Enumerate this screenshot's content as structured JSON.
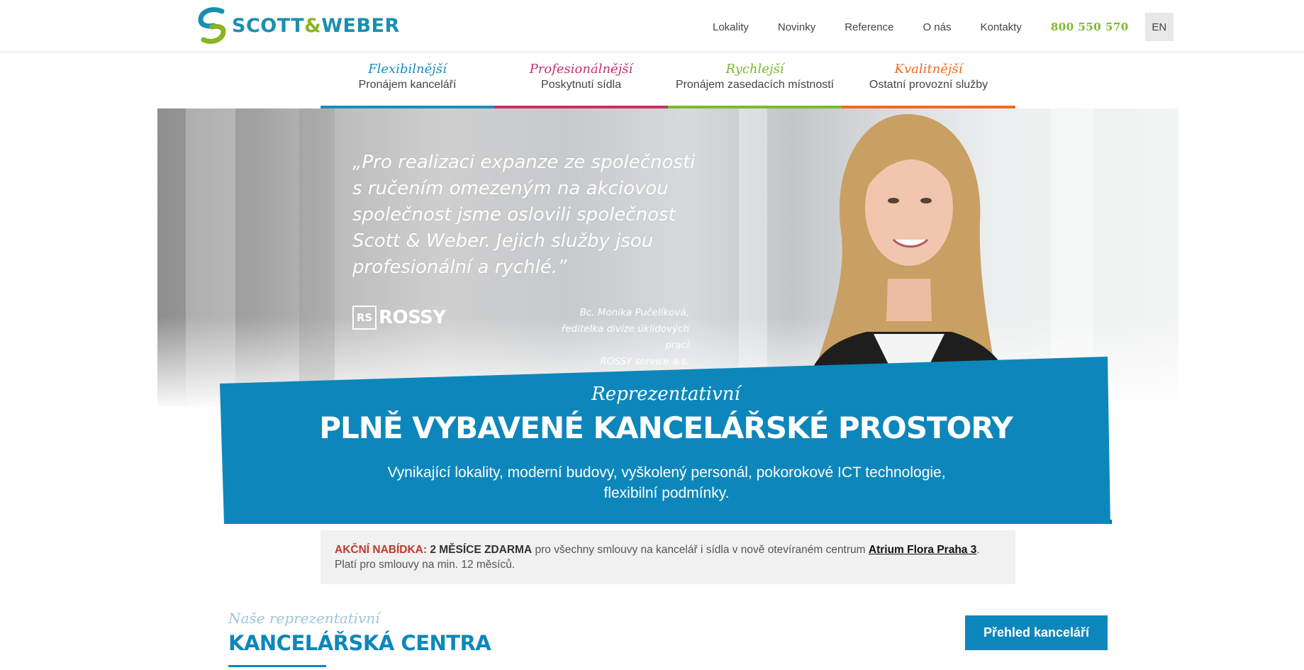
{
  "header": {
    "logo_text": "SCOTT",
    "logo_amp": "&",
    "logo_text2": "WEBER",
    "nav": [
      {
        "label": "Lokality"
      },
      {
        "label": "Novinky"
      },
      {
        "label": "Reference"
      },
      {
        "label": "O nás"
      },
      {
        "label": "Kontakty"
      }
    ],
    "phone": "800 550 570",
    "lang": "EN"
  },
  "tabs": [
    {
      "title": "Flexibilnější",
      "subtitle": "Pronájem kanceláří",
      "color": "#1a8fb9"
    },
    {
      "title": "Profesionálnější",
      "subtitle": "Poskytnutí sídla",
      "color": "#c7306a"
    },
    {
      "title": "Rychlejší",
      "subtitle": "Pronájem zasedacích místností",
      "color": "#7cb92c"
    },
    {
      "title": "Kvalitnější",
      "subtitle": "Ostatní provozní služby",
      "color": "#f26a21"
    }
  ],
  "hero": {
    "quote": "„Pro realizaci expanze ze společnosti s ručením omezeným na akciovou společnost jsme oslovili společnost Scott & Weber. Jejich služby jsou profesionální a rychlé.”",
    "sig_name": "Bc. Monika Pučelíková,",
    "sig_role": "ředitelka divize úklidových prací",
    "sig_company": "ROSSY service a.s.",
    "brand_mark": "RS",
    "brand_word": "ROSSY"
  },
  "banner": {
    "kicker": "Reprezentativní",
    "title": "PLNĚ VYBAVENÉ KANCELÁŘSKÉ PROSTORY",
    "text": "Vynikající lokality, moderní budovy, vyškolený personál, pokorokové ICT technologie, flexibilní podmínky."
  },
  "offer": {
    "label": "AKČNÍ NABÍDKA:",
    "strong": "2 MĚSÍCE ZDARMA",
    "text": "pro všechny smlouvy na kancelář i sídla v nově otevíraném centrum",
    "link": "Atrium Flora Praha 3",
    "end": ".",
    "note": "Platí pro smlouvy na min. 12 měsíců."
  },
  "section": {
    "kicker": "Naše reprezentativní",
    "title": "KANCELÁŘSKÁ CENTRA",
    "button": "Přehled kanceláří"
  },
  "colors": {
    "brand_blue": "#0d87bb",
    "brand_green": "#8cb320",
    "phone_green": "#7cb92c",
    "offer_red": "#c0392b"
  }
}
